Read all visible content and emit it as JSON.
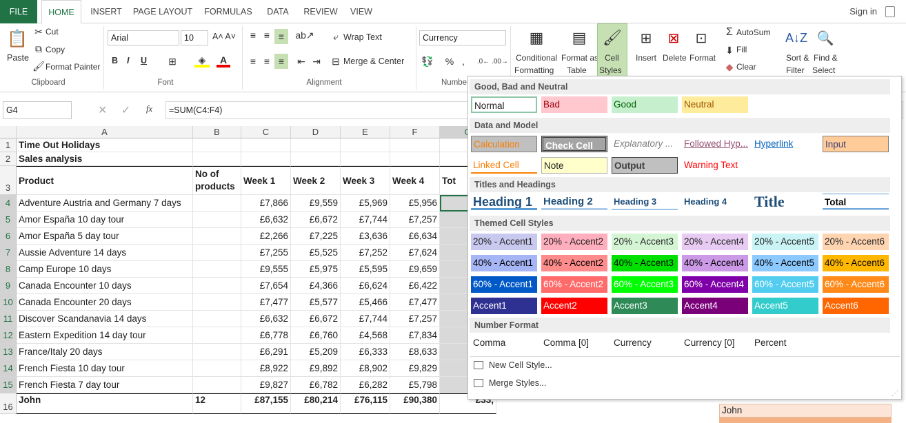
{
  "tabs": [
    "FILE",
    "HOME",
    "INSERT",
    "PAGE LAYOUT",
    "FORMULAS",
    "DATA",
    "REVIEW",
    "VIEW"
  ],
  "signin": "Sign in",
  "clipboard": {
    "paste": "Paste",
    "cut": "Cut",
    "copy": "Copy",
    "format_painter": "Format Painter",
    "label": "Clipboard"
  },
  "font": {
    "name": "Arial",
    "size": "10",
    "bold": "B",
    "italic": "I",
    "underline": "U",
    "label": "Font"
  },
  "alignment": {
    "wrap": "Wrap Text",
    "merge": "Merge & Center",
    "label": "Alignment"
  },
  "number": {
    "format": "Currency",
    "label": "Number"
  },
  "styles": {
    "conditional": "Conditional",
    "conditional2": "Formatting",
    "format_as": "Format as",
    "table": "Table",
    "cell": "Cell",
    "cell_styles": "Styles"
  },
  "cells": {
    "insert": "Insert",
    "delete": "Delete",
    "format": "Format"
  },
  "editing": {
    "autosum": "AutoSum",
    "fill": "Fill",
    "clear": "Clear",
    "sort": "Sort &",
    "filter": "Filter",
    "find": "Find &",
    "select": "Select"
  },
  "formula": {
    "namebox": "G4",
    "fx": "fx",
    "value": "=SUM(C4:F4)"
  },
  "columns": [
    "A",
    "B",
    "C",
    "D",
    "E",
    "F",
    "G"
  ],
  "rows": [
    {
      "n": "1",
      "a": "Time Out Holidays",
      "bold": true
    },
    {
      "n": "2",
      "a": "Sales analysis",
      "bold": true
    },
    {
      "n": "3",
      "a": "Product",
      "b": "No of products",
      "c": "Week 1",
      "d": "Week 2",
      "e": "Week 3",
      "f": "Week 4",
      "g": "Tot",
      "bold": true
    },
    {
      "n": "4",
      "a": "Adventure Austria and Germany 7 days",
      "c": "£7,866",
      "d": "£9,559",
      "e": "£5,969",
      "f": "£5,956",
      "g": "£"
    },
    {
      "n": "5",
      "a": "Amor España 10 day tour",
      "c": "£6,632",
      "d": "£6,672",
      "e": "£7,744",
      "f": "£7,257",
      "g": "£"
    },
    {
      "n": "6",
      "a": "Amor España 5 day tour",
      "c": "£2,266",
      "d": "£7,225",
      "e": "£3,636",
      "f": "£6,634",
      "g": "£"
    },
    {
      "n": "7",
      "a": "Aussie Adventure 14 days",
      "c": "£7,255",
      "d": "£5,525",
      "e": "£7,252",
      "f": "£7,624",
      "g": "£"
    },
    {
      "n": "8",
      "a": "Camp Europe 10 days",
      "c": "£9,555",
      "d": "£5,975",
      "e": "£5,595",
      "f": "£9,659",
      "g": "£"
    },
    {
      "n": "9",
      "a": "Canada Encounter 10 days",
      "c": "£7,654",
      "d": "£4,366",
      "e": "£6,624",
      "f": "£6,422",
      "g": "£"
    },
    {
      "n": "10",
      "a": "Canada Encounter 20 days",
      "c": "£7,477",
      "d": "£5,577",
      "e": "£5,466",
      "f": "£7,477",
      "g": "£"
    },
    {
      "n": "11",
      "a": "Discover Scandanavia 14 days",
      "c": "£6,632",
      "d": "£6,672",
      "e": "£7,744",
      "f": "£7,257",
      "g": "£"
    },
    {
      "n": "12",
      "a": "Eastern Expedition 14 day tour",
      "c": "£6,778",
      "d": "£6,760",
      "e": "£4,568",
      "f": "£7,834",
      "g": "£"
    },
    {
      "n": "13",
      "a": "France/Italy 20 days",
      "c": "£6,291",
      "d": "£5,209",
      "e": "£6,333",
      "f": "£8,633",
      "g": "£"
    },
    {
      "n": "14",
      "a": "French Fiesta 10 day tour",
      "c": "£8,922",
      "d": "£9,892",
      "e": "£8,902",
      "f": "£9,829",
      "g": "£"
    },
    {
      "n": "15",
      "a": "French Fiesta 7 day tour",
      "c": "£9,827",
      "d": "£6,782",
      "e": "£6,282",
      "f": "£5,798",
      "g": "£"
    },
    {
      "n": "16",
      "a": "John",
      "b": "12",
      "c": "£87,155",
      "d": "£80,214",
      "e": "£76,115",
      "f": "£90,380",
      "g": "£33,",
      "bold": true
    }
  ],
  "bottom_right": "John",
  "dropdown": {
    "sections": [
      "Good, Bad and Neutral",
      "Data and Model",
      "Titles and Headings",
      "Themed Cell Styles",
      "Number Format"
    ],
    "good_bad": [
      "Normal",
      "Bad",
      "Good",
      "Neutral"
    ],
    "data_model_1": [
      "Calculation",
      "Check Cell",
      "Explanatory ...",
      "Followed Hyp...",
      "Hyperlink",
      "Input"
    ],
    "data_model_2": [
      "Linked Cell",
      "Note",
      "Output",
      "Warning Text"
    ],
    "titles": [
      "Heading 1",
      "Heading 2",
      "Heading 3",
      "Heading 4",
      "Title",
      "Total"
    ],
    "accent20": [
      "20% - Accent1",
      "20% - Accent2",
      "20% - Accent3",
      "20% - Accent4",
      "20% - Accent5",
      "20% - Accent6"
    ],
    "accent40": [
      "40% - Accent1",
      "40% - Accent2",
      "40% - Accent3",
      "40% - Accent4",
      "40% - Accent5",
      "40% - Accent6"
    ],
    "accent60": [
      "60% - Accent1",
      "60% - Accent2",
      "60% - Accent3",
      "60% - Accent4",
      "60% - Accent5",
      "60% - Accent6"
    ],
    "accent": [
      "Accent1",
      "Accent2",
      "Accent3",
      "Accent4",
      "Accent5",
      "Accent6"
    ],
    "number_format": [
      "Comma",
      "Comma [0]",
      "Currency",
      "Currency [0]",
      "Percent"
    ],
    "new_style": "New Cell Style...",
    "merge_styles": "Merge Styles..."
  },
  "colors": {
    "excel_green": "#217346",
    "accent_green": "#2e8b57"
  }
}
